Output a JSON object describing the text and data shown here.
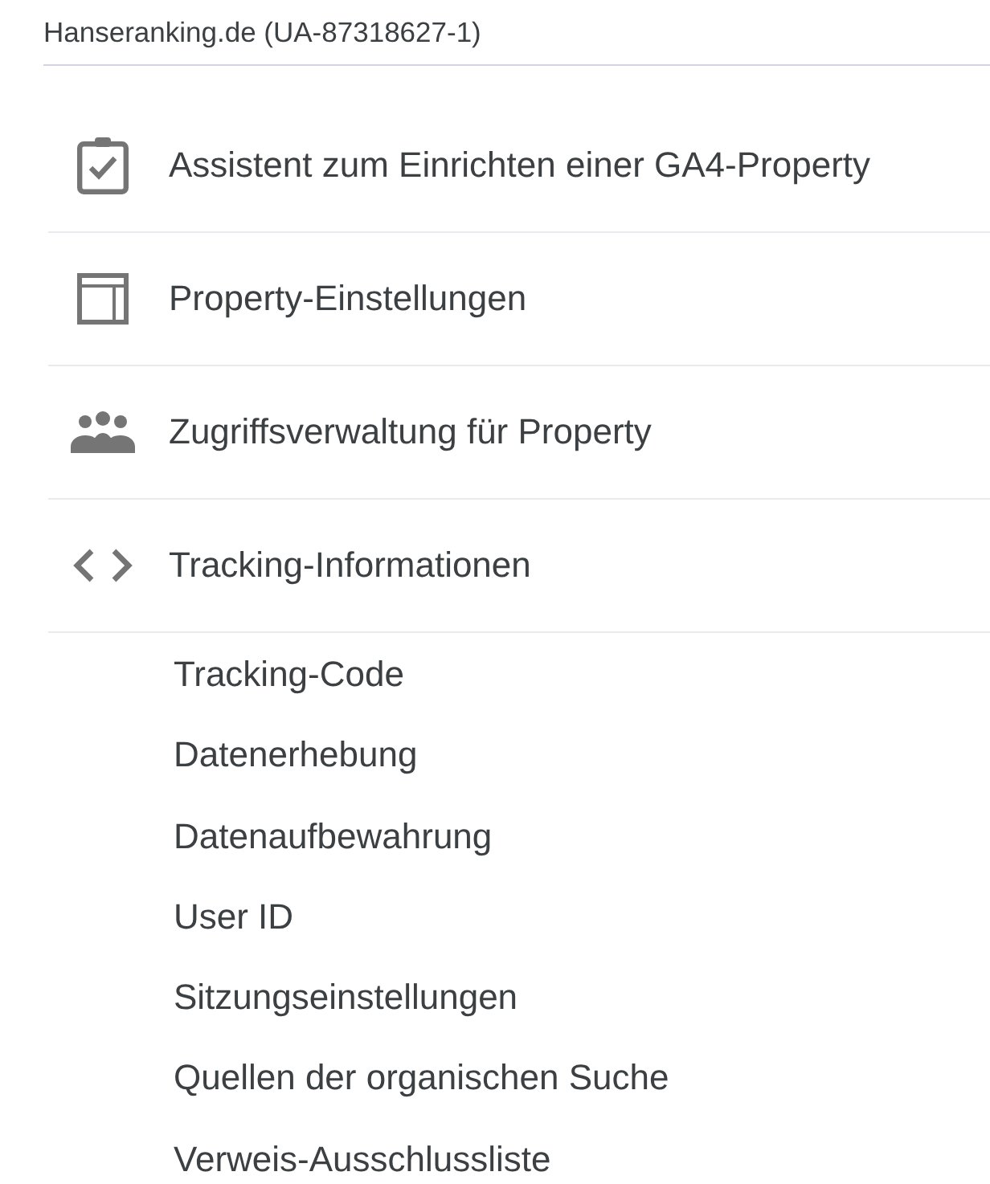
{
  "property": {
    "title": "Hanseranking.de (UA-87318627-1)"
  },
  "sections": [
    {
      "label": "Assistent zum Einrichten einer GA4-Property"
    },
    {
      "label": "Property-Einstellungen"
    },
    {
      "label": "Zugriffsverwaltung für Property"
    },
    {
      "label": "Tracking-Informationen",
      "children": [
        {
          "label": "Tracking-Code"
        },
        {
          "label": "Datenerhebung"
        },
        {
          "label": "Datenaufbewahrung"
        },
        {
          "label": "User ID"
        },
        {
          "label": "Sitzungseinstellungen"
        },
        {
          "label": "Quellen der organischen Suche"
        },
        {
          "label": "Verweis-Ausschlussliste"
        }
      ]
    }
  ]
}
